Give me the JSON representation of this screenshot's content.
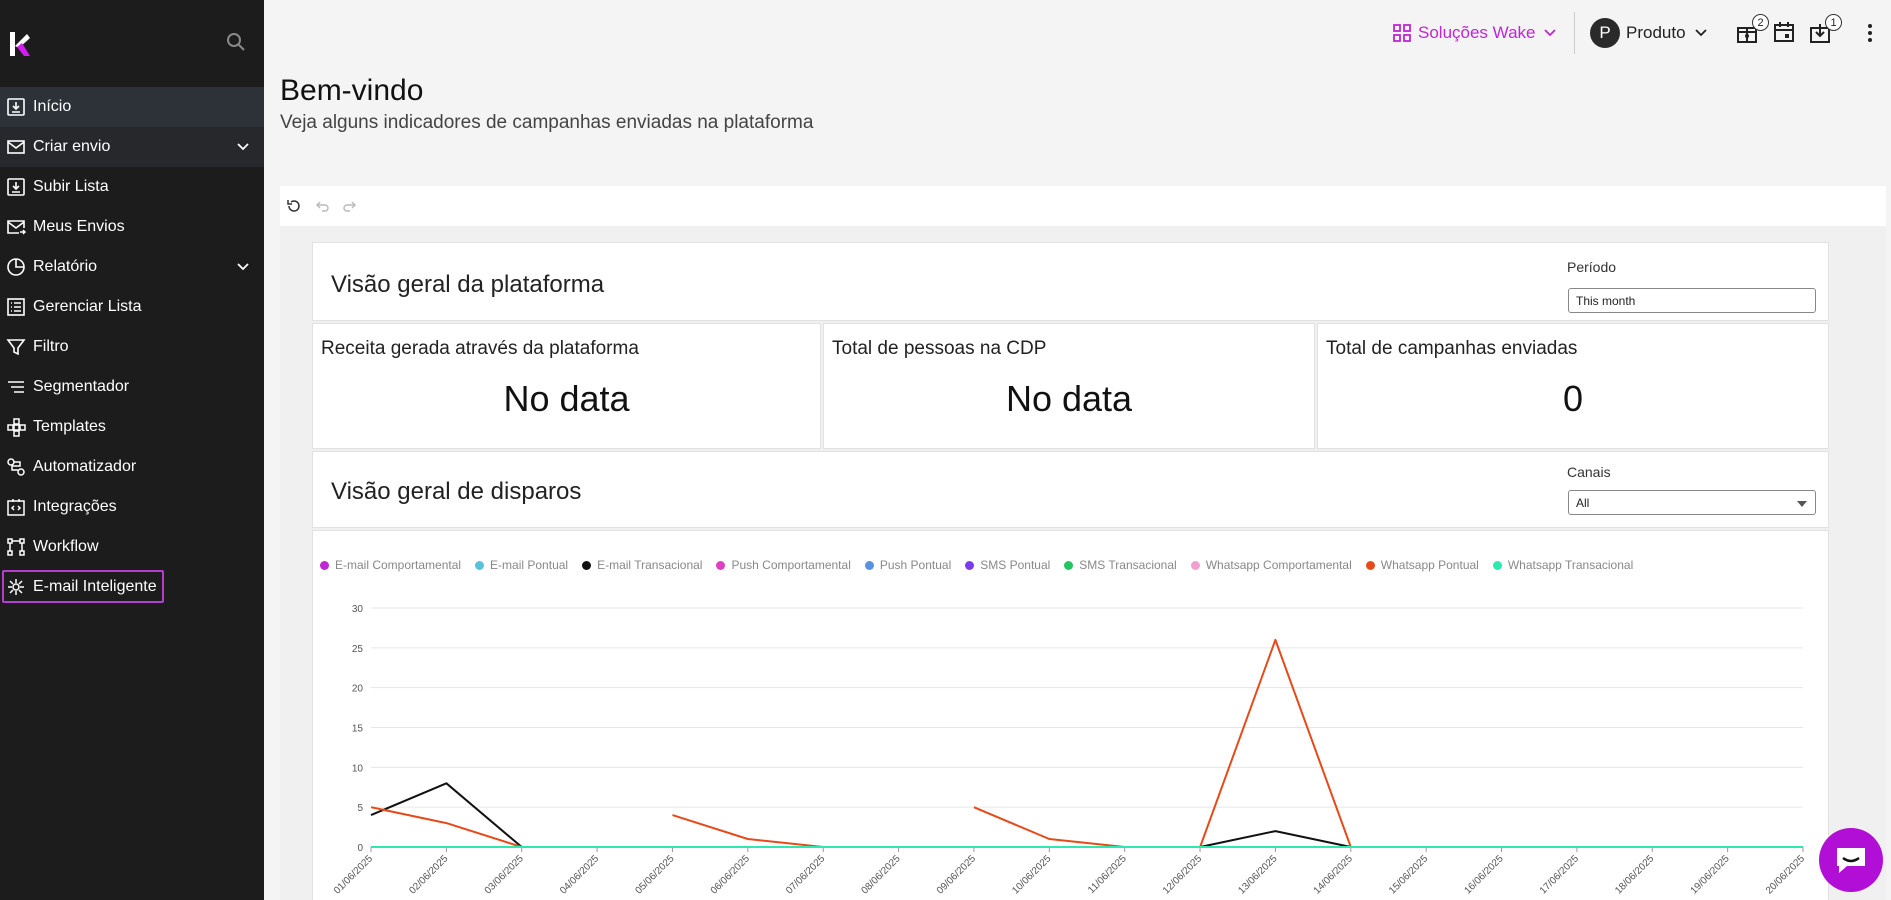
{
  "sidebar": {
    "items": [
      {
        "label": "Início",
        "icon": "download-box-icon"
      },
      {
        "label": "Criar envio",
        "icon": "mail-icon",
        "has_children": true
      },
      {
        "label": "Subir Lista",
        "icon": "upload-list-icon"
      },
      {
        "label": "Meus Envios",
        "icon": "sent-mail-icon"
      },
      {
        "label": "Relatório",
        "icon": "pie-chart-icon",
        "has_children": true
      },
      {
        "label": "Gerenciar Lista",
        "icon": "list-icon"
      },
      {
        "label": "Filtro",
        "icon": "filter-icon"
      },
      {
        "label": "Segmentador",
        "icon": "segment-icon"
      },
      {
        "label": "Templates",
        "icon": "templates-icon"
      },
      {
        "label": "Automatizador",
        "icon": "automation-icon"
      },
      {
        "label": "Integrações",
        "icon": "integration-icon"
      },
      {
        "label": "Workflow",
        "icon": "workflow-icon"
      },
      {
        "label": "E-mail Inteligente",
        "icon": "smart-mail-icon"
      }
    ]
  },
  "header": {
    "brand_switch": "Soluções Wake",
    "profile_initial": "P",
    "profile_name": "Produto",
    "notifications_badge": "2",
    "downloads_badge": "1",
    "accent_color": "#c026d3"
  },
  "page": {
    "title": "Bem-vindo",
    "subtitle": "Veja alguns indicadores de campanhas enviadas na plataforma"
  },
  "overview": {
    "title": "Visão geral da plataforma",
    "period_label": "Período",
    "period_value": "This month",
    "kpis": [
      {
        "label": "Receita gerada através da plataforma",
        "value": "No data"
      },
      {
        "label": "Total de pessoas na CDP",
        "value": "No data"
      },
      {
        "label": "Total de campanhas enviadas",
        "value": "0"
      }
    ]
  },
  "dispatch": {
    "title": "Visão geral de disparos",
    "channels_label": "Canais",
    "channels_value": "All"
  },
  "chart_data": {
    "type": "line",
    "x": [
      "01/06/2025",
      "02/06/2025",
      "03/06/2025",
      "04/06/2025",
      "05/06/2025",
      "06/06/2025",
      "07/06/2025",
      "08/06/2025",
      "09/06/2025",
      "10/06/2025",
      "11/06/2025",
      "12/06/2025",
      "13/06/2025",
      "14/06/2025",
      "15/06/2025",
      "16/06/2025",
      "17/06/2025",
      "18/06/2025",
      "19/06/2025",
      "20/06/2025"
    ],
    "yticks": [
      0,
      5,
      10,
      15,
      20,
      25,
      30
    ],
    "ylim": [
      0,
      30
    ],
    "grid": true,
    "legend_position": "top",
    "series": [
      {
        "name": "E-mail Comportamental",
        "color": "#c026d3",
        "values": [
          0,
          0,
          0,
          0,
          0,
          0,
          0,
          0,
          0,
          0,
          0,
          0,
          0,
          0,
          0,
          0,
          0,
          0,
          0,
          0
        ]
      },
      {
        "name": "E-mail Pontual",
        "color": "#5bc0de",
        "values": [
          0,
          0,
          0,
          0,
          0,
          0,
          0,
          0,
          0,
          0,
          0,
          0,
          0,
          0,
          0,
          0,
          0,
          0,
          0,
          0
        ]
      },
      {
        "name": "E-mail Transacional",
        "color": "#111111",
        "values": [
          4,
          8,
          0,
          null,
          null,
          null,
          null,
          null,
          null,
          null,
          null,
          0,
          2,
          0,
          null,
          null,
          null,
          null,
          null,
          null
        ]
      },
      {
        "name": "Push Comportamental",
        "color": "#e040c0",
        "values": [
          0,
          0,
          0,
          0,
          0,
          0,
          0,
          0,
          0,
          0,
          0,
          0,
          0,
          0,
          0,
          0,
          0,
          0,
          0,
          0
        ]
      },
      {
        "name": "Push Pontual",
        "color": "#5b8fe0",
        "values": [
          0,
          0,
          0,
          0,
          0,
          0,
          0,
          0,
          0,
          0,
          0,
          0,
          0,
          0,
          0,
          0,
          0,
          0,
          0,
          0
        ]
      },
      {
        "name": "SMS Pontual",
        "color": "#7c3aed",
        "values": [
          0,
          0,
          0,
          0,
          0,
          0,
          0,
          0,
          0,
          0,
          0,
          0,
          0,
          0,
          0,
          0,
          0,
          0,
          0,
          0
        ]
      },
      {
        "name": "SMS Transacional",
        "color": "#22c55e",
        "values": [
          0,
          0,
          0,
          0,
          0,
          0,
          0,
          0,
          0,
          0,
          0,
          0,
          0,
          0,
          0,
          0,
          0,
          0,
          0,
          0
        ]
      },
      {
        "name": "Whatsapp Comportamental",
        "color": "#f0a0d0",
        "values": [
          0,
          0,
          0,
          0,
          0,
          0,
          0,
          0,
          0,
          0,
          0,
          0,
          0,
          0,
          0,
          0,
          0,
          0,
          0,
          0
        ]
      },
      {
        "name": "Whatsapp Pontual",
        "color": "#e64a19",
        "values": [
          5,
          3,
          0,
          null,
          4,
          1,
          0,
          null,
          5,
          1,
          0,
          0,
          26,
          0,
          null,
          null,
          null,
          null,
          null,
          null
        ]
      },
      {
        "name": "Whatsapp Transacional",
        "color": "#2ee8b0",
        "values": [
          0,
          0,
          0,
          0,
          0,
          0,
          0,
          0,
          0,
          0,
          0,
          0,
          0,
          0,
          0,
          0,
          0,
          0,
          0,
          0
        ]
      }
    ]
  }
}
